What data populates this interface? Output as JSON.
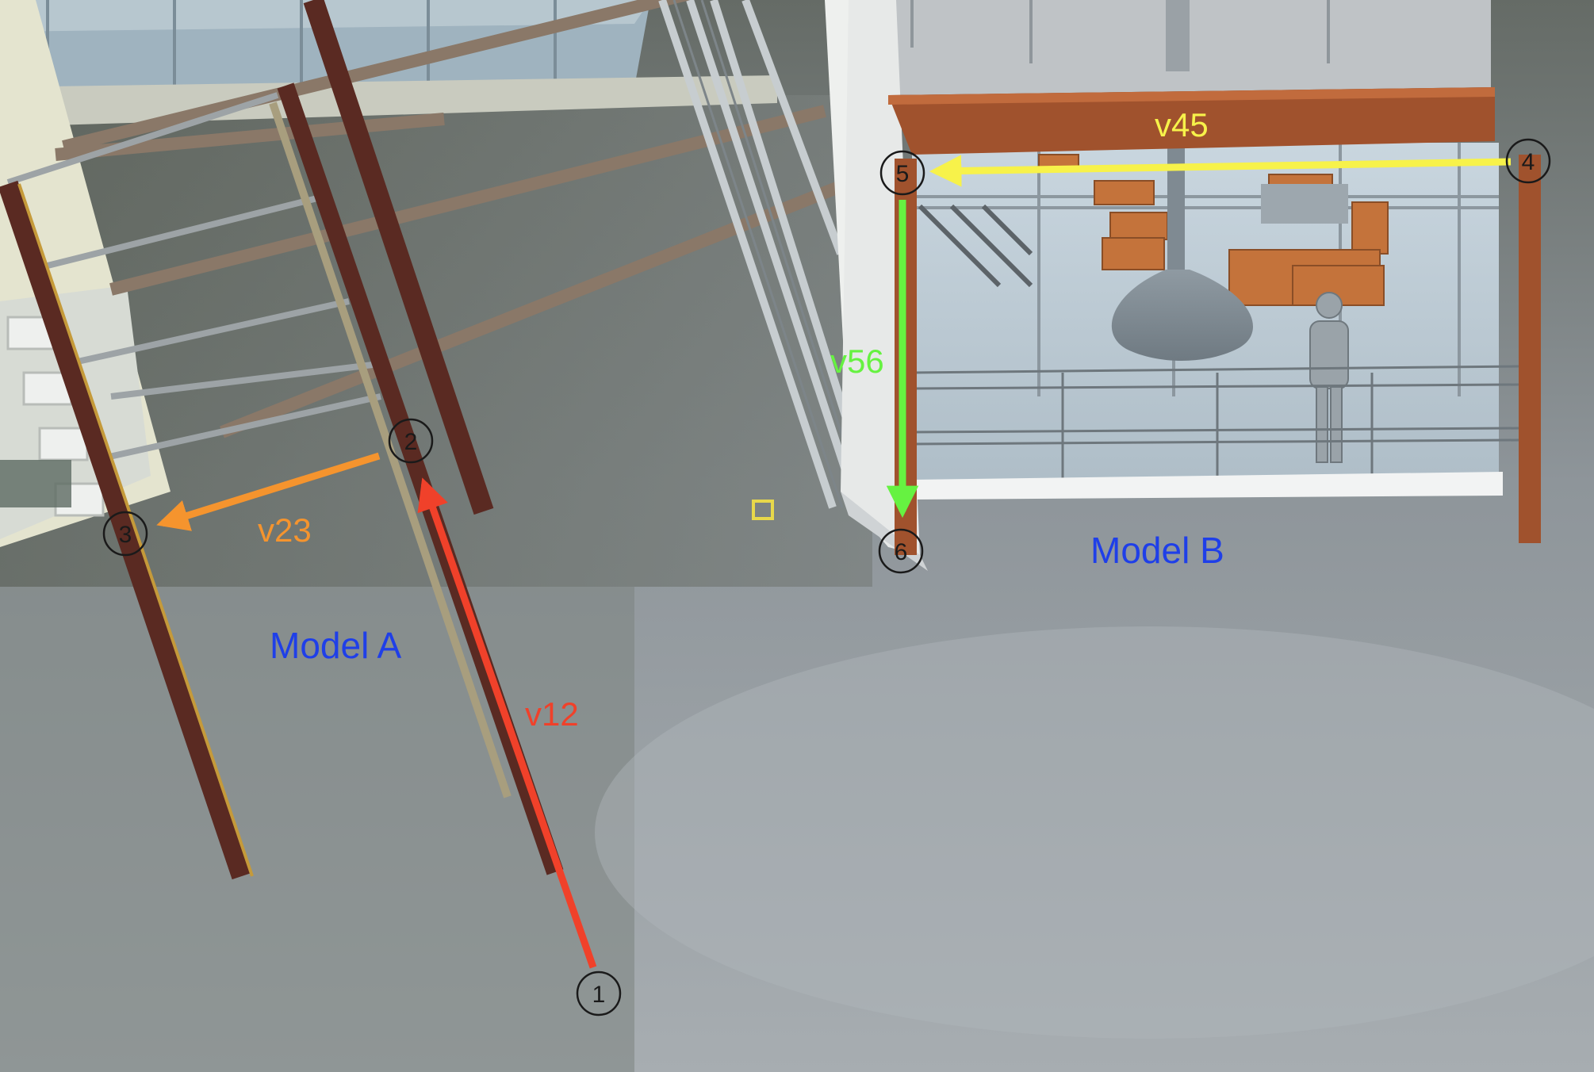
{
  "models": [
    {
      "id": "model-a",
      "label": "Model A"
    },
    {
      "id": "model-b",
      "label": "Model B"
    }
  ],
  "points": [
    {
      "id": "p1",
      "label": "1"
    },
    {
      "id": "p2",
      "label": "2"
    },
    {
      "id": "p3",
      "label": "3"
    },
    {
      "id": "p4",
      "label": "4"
    },
    {
      "id": "p5",
      "label": "5"
    },
    {
      "id": "p6",
      "label": "6"
    }
  ],
  "vectors": [
    {
      "id": "v12",
      "label": "v12",
      "color": "#f0412a"
    },
    {
      "id": "v23",
      "label": "v23",
      "color": "#f5942e"
    },
    {
      "id": "v45",
      "label": "v45",
      "color": "#f7f24a"
    },
    {
      "id": "v56",
      "label": "v56",
      "color": "#66f241"
    }
  ],
  "colors": {
    "model_label": "#1f3fe8",
    "point_circle": "#1a1a1a",
    "steel_column": "#5a2a22",
    "timber_beam": "#a0522d",
    "glass": "#b9c9d4",
    "ground": "#9aa1a6",
    "pick_marker": "#e8d84a"
  }
}
